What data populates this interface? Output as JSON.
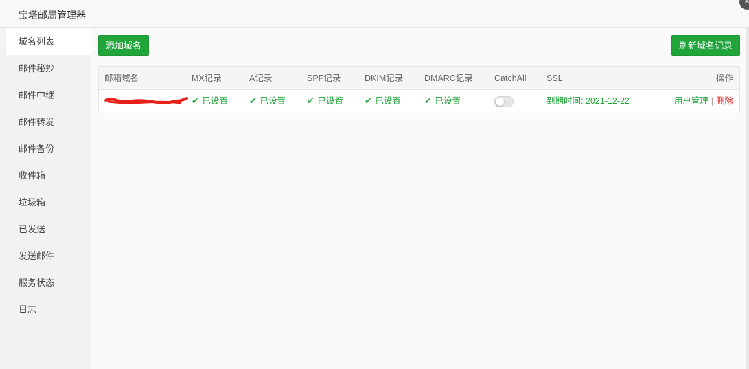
{
  "window": {
    "title": "宝塔邮局管理器",
    "close_label": "×"
  },
  "sidebar": {
    "items": [
      {
        "label": "域名列表",
        "active": true
      },
      {
        "label": "邮件秘抄",
        "active": false
      },
      {
        "label": "邮件中继",
        "active": false
      },
      {
        "label": "邮件转发",
        "active": false
      },
      {
        "label": "邮件备份",
        "active": false
      },
      {
        "label": "收件箱",
        "active": false
      },
      {
        "label": "垃圾箱",
        "active": false
      },
      {
        "label": "已发送",
        "active": false
      },
      {
        "label": "发送邮件",
        "active": false
      },
      {
        "label": "服务状态",
        "active": false
      },
      {
        "label": "日志",
        "active": false
      }
    ]
  },
  "toolbar": {
    "add_label": "添加域名",
    "refresh_label": "刷新域名记录"
  },
  "table": {
    "headers": [
      "邮箱域名",
      "MX记录",
      "A记录",
      "SPF记录",
      "DKIM记录",
      "DMARC记录",
      "CatchAll",
      "SSL",
      "操作"
    ],
    "rows": [
      {
        "domain": "",
        "mx": "已设置",
        "a": "已设置",
        "spf": "已设置",
        "dkim": "已设置",
        "dmarc": "已设置",
        "catchall_enabled": false,
        "ssl": "到期时间: 2021-12-22",
        "actions": {
          "manage": "用户管理",
          "separator": "|",
          "delete": "删除"
        }
      }
    ]
  },
  "colors": {
    "accent": "#20a53a",
    "danger": "#e03131",
    "redaction": "#e8201a"
  }
}
